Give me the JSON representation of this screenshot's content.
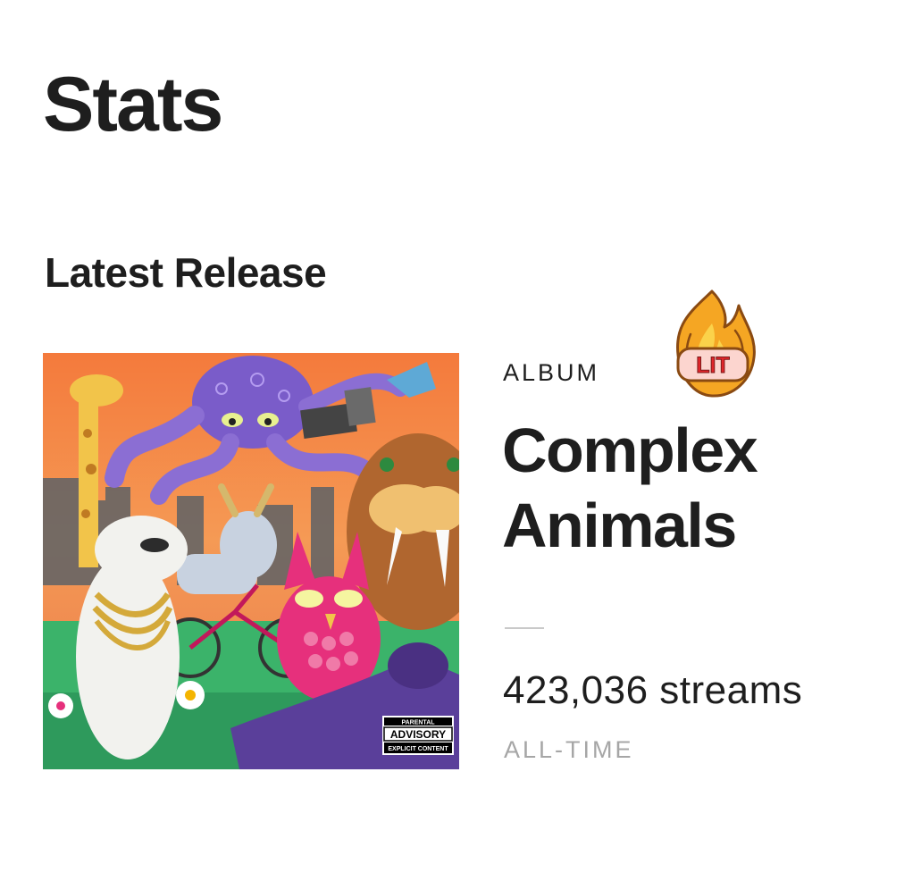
{
  "header": {
    "title": "Stats"
  },
  "latest_release": {
    "section_title": "Latest Release",
    "type_label": "ALBUM",
    "sticker_text": "LIT",
    "sticker_icon": "fire-icon",
    "album_title": "Complex Animals",
    "streams": "423,036 streams",
    "period": "ALL-TIME",
    "advisory_label": {
      "top": "PARENTAL",
      "main": "ADVISORY",
      "bottom": "EXPLICIT CONTENT"
    }
  },
  "colors": {
    "text": "#1e1e1e",
    "muted": "#a6a6a6",
    "divider": "#c9c9c9",
    "fire_outer": "#f5a623",
    "fire_inner": "#fbd24a",
    "sticker_text": "#e2262b"
  }
}
